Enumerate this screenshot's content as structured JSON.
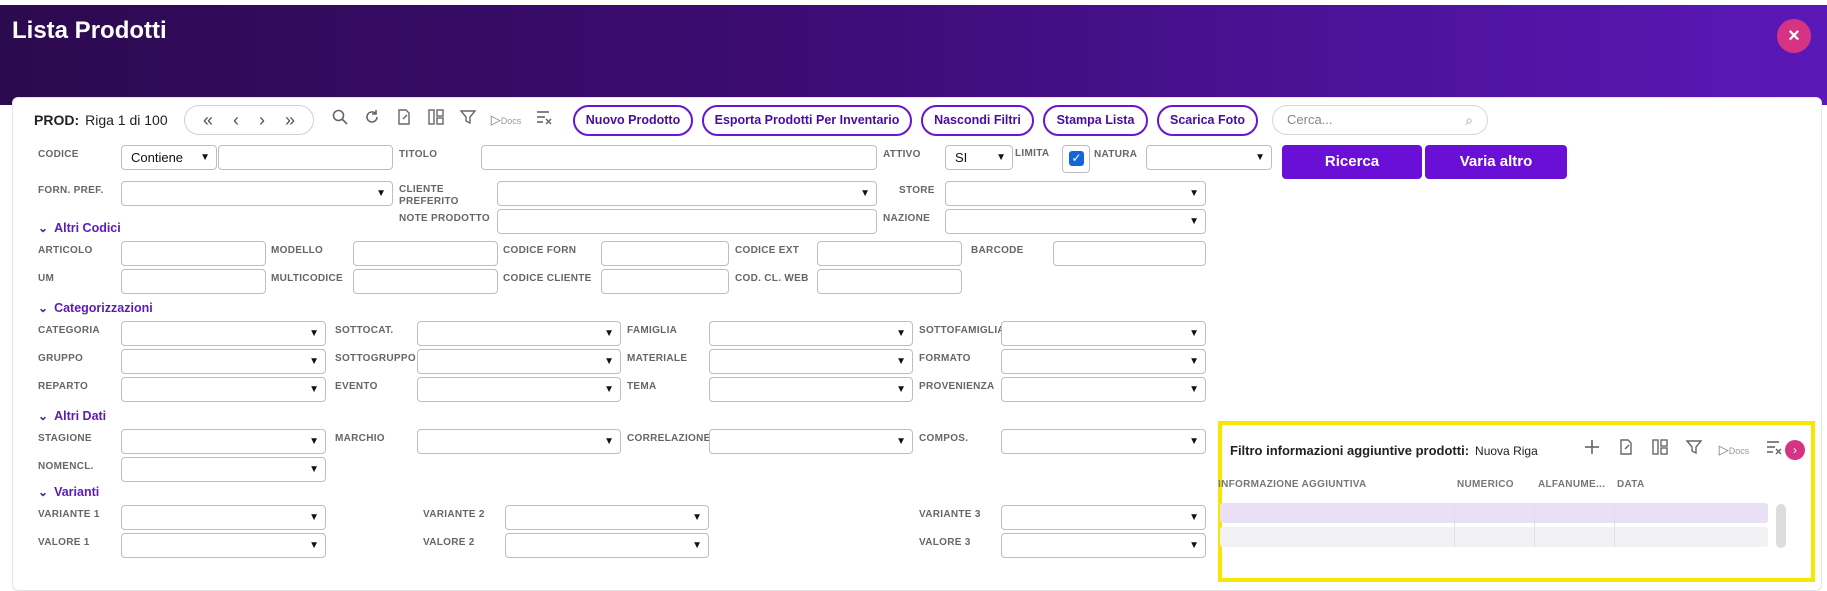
{
  "header": {
    "title": "Lista Prodotti",
    "close_label": "×"
  },
  "toolbar": {
    "record_prefix": "PROD:",
    "record_label": "Riga 1 di 100",
    "nav": [
      "«",
      "‹",
      "›",
      "»"
    ],
    "docs_label": "Docs",
    "buttons": [
      "Nuovo Prodotto",
      "Esporta Prodotti Per Inventario",
      "Nascondi Filtri",
      "Stampa Lista",
      "Scarica Foto"
    ],
    "search_placeholder": "Cerca..."
  },
  "filters": {
    "codice": "CODICE",
    "codice_mode": "Contiene",
    "titolo": "TITOLO",
    "attivo": "ATTIVO",
    "attivo_value": "SI",
    "limita": "LIMITA",
    "natura": "NATURA",
    "ricerca": "Ricerca",
    "varia_altro": "Varia altro",
    "forn_pref": "FORN. PREF.",
    "cliente_preferito": "CLIENTE PREFERITO",
    "store": "STORE",
    "note_prodotto": "NOTE PRODOTTO",
    "nazione": "NAZIONE"
  },
  "sections": {
    "altri_codici": "Altri Codici",
    "categorizzazioni": "Categorizzazioni",
    "altri_dati": "Altri Dati",
    "varianti": "Varianti"
  },
  "altri_codici": {
    "articolo": "ARTICOLO",
    "modello": "MODELLO",
    "codice_forn": "CODICE FORN",
    "codice_ext": "CODICE EXT",
    "barcode": "BARCODE",
    "um": "UM",
    "multicodice": "MULTICODICE",
    "codice_cliente": "CODICE CLIENTE",
    "cod_cl_web": "COD. CL. WEB"
  },
  "categorizzazioni": {
    "categoria": "CATEGORIA",
    "sottocat": "SOTTOCAT.",
    "famiglia": "FAMIGLIA",
    "sottofamiglia": "SOTTOFAMIGLIA",
    "gruppo": "GRUPPO",
    "sottogruppo": "SOTTOGRUPPO",
    "materiale": "MATERIALE",
    "formato": "FORMATO",
    "reparto": "REPARTO",
    "evento": "EVENTO",
    "tema": "TEMA",
    "provenienza": "PROVENIENZA"
  },
  "altri_dati": {
    "stagione": "STAGIONE",
    "marchio": "MARCHIO",
    "correlazione": "CORRELAZIONE",
    "compos": "COMPOS.",
    "nomencl": "NOMENCL."
  },
  "varianti": {
    "variante1": "VARIANTE 1",
    "variante2": "VARIANTE 2",
    "variante3": "VARIANTE 3",
    "valore1": "VALORE 1",
    "valore2": "VALORE 2",
    "valore3": "VALORE 3"
  },
  "sub_grid": {
    "title": "Filtro informazioni aggiuntive prodotti:",
    "mode": "Nuova Riga",
    "docs_label": "Docs",
    "columns": [
      "INFORMAZIONE AGGIUNTIVA",
      "NUMERICO",
      "ALFANUME...",
      "DATA"
    ]
  },
  "colors": {
    "accent": "#6a0fd6",
    "highlight": "#f7e600",
    "close": "#d63384"
  }
}
